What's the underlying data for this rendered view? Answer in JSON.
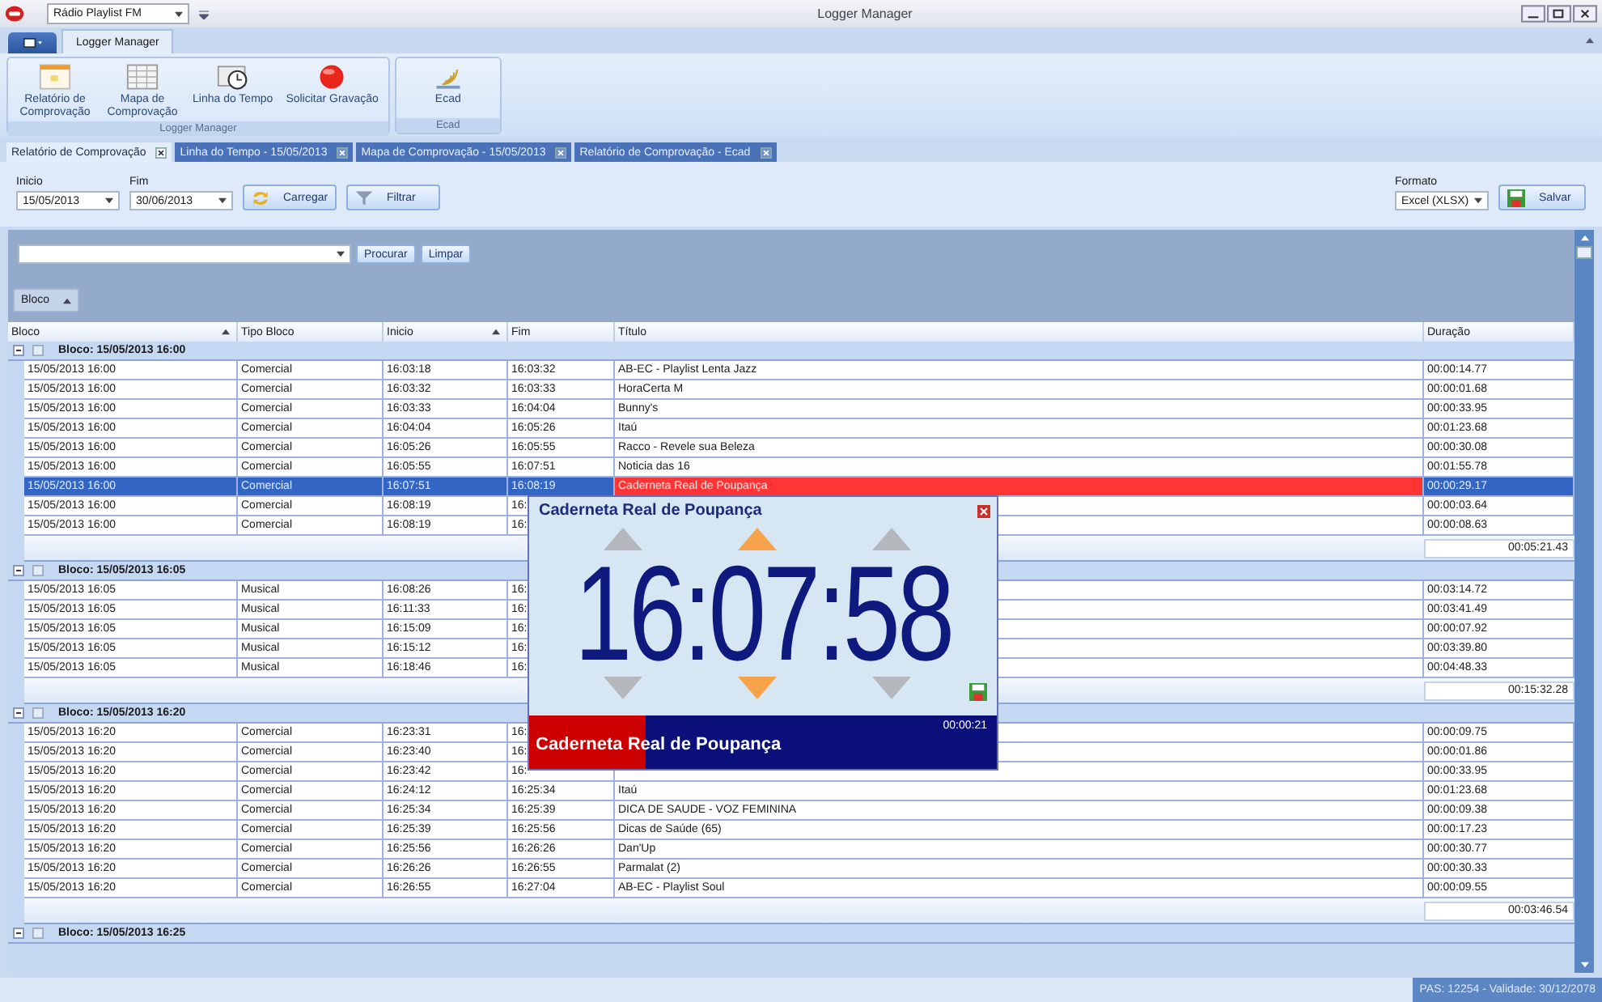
{
  "window": {
    "title": "Logger Manager",
    "station": "Rádio Playlist FM"
  },
  "ribbon": {
    "tabs": [
      {
        "label": "Logger Manager",
        "selected": true
      }
    ],
    "groups": [
      {
        "label": "Logger Manager",
        "buttons": [
          {
            "label": "Relatório de Comprovação",
            "kind": "report"
          },
          {
            "label": "Mapa de Comprovação",
            "kind": "map"
          },
          {
            "label": "Linha do Tempo",
            "kind": "timeline"
          },
          {
            "label": "Solicitar Gravação",
            "kind": "record"
          }
        ]
      },
      {
        "label": "Ecad",
        "buttons": [
          {
            "label": "Ecad",
            "kind": "ecad"
          }
        ]
      }
    ]
  },
  "doc_tabs": [
    {
      "label": "Relatório de Comprovação",
      "selected": true
    },
    {
      "label": "Linha do Tempo - 15/05/2013",
      "selected": false
    },
    {
      "label": "Mapa de Comprovação - 15/05/2013",
      "selected": false
    },
    {
      "label": "Relatório de Comprovação - Ecad",
      "selected": false
    }
  ],
  "filter": {
    "start": {
      "label": "Inicio",
      "value": "15/05/2013"
    },
    "end": {
      "label": "Fim",
      "value": "30/06/2013"
    },
    "load_button": "Carregar",
    "filter_button": "Filtrar",
    "format": {
      "label": "Formato",
      "value": "Excel (XLSX)"
    },
    "save_button": "Salvar"
  },
  "search": {
    "search_button": "Procurar",
    "clear_button": "Limpar"
  },
  "group_by": {
    "label": "Bloco"
  },
  "table": {
    "columns": [
      {
        "label": "Bloco",
        "sorted": true
      },
      {
        "label": "Tipo Bloco",
        "sorted": false
      },
      {
        "label": "Inicio",
        "sorted": true
      },
      {
        "label": "Fim",
        "sorted": false
      },
      {
        "label": "Título",
        "sorted": false
      },
      {
        "label": "Duração",
        "sorted": false
      }
    ],
    "groups": [
      {
        "label": "Bloco: 15/05/2013 16:00",
        "expanded": true,
        "checked": false,
        "total": "00:05:21.43",
        "rows": [
          {
            "bloco": "15/05/2013 16:00",
            "tipo": "Comercial",
            "inicio": "16:03:18",
            "fim": "16:03:32",
            "titulo": "AB-EC - Playlist Lenta Jazz",
            "duracao": "00:00:14.77",
            "selected": false
          },
          {
            "bloco": "15/05/2013 16:00",
            "tipo": "Comercial",
            "inicio": "16:03:32",
            "fim": "16:03:33",
            "titulo": "HoraCerta M",
            "duracao": "00:00:01.68",
            "selected": false
          },
          {
            "bloco": "15/05/2013 16:00",
            "tipo": "Comercial",
            "inicio": "16:03:33",
            "fim": "16:04:04",
            "titulo": "Bunny's",
            "duracao": "00:00:33.95",
            "selected": false
          },
          {
            "bloco": "15/05/2013 16:00",
            "tipo": "Comercial",
            "inicio": "16:04:04",
            "fim": "16:05:26",
            "titulo": "Itaú",
            "duracao": "00:01:23.68",
            "selected": false
          },
          {
            "bloco": "15/05/2013 16:00",
            "tipo": "Comercial",
            "inicio": "16:05:26",
            "fim": "16:05:55",
            "titulo": "Racco - Revele sua Beleza",
            "duracao": "00:00:30.08",
            "selected": false
          },
          {
            "bloco": "15/05/2013 16:00",
            "tipo": "Comercial",
            "inicio": "16:05:55",
            "fim": "16:07:51",
            "titulo": "Noticia das 16",
            "duracao": "00:01:55.78",
            "selected": false
          },
          {
            "bloco": "15/05/2013 16:00",
            "tipo": "Comercial",
            "inicio": "16:07:51",
            "fim": "16:08:19",
            "titulo": "Caderneta Real de Poupança",
            "duracao": "00:00:29.17",
            "selected": true
          },
          {
            "bloco": "15/05/2013 16:00",
            "tipo": "Comercial",
            "inicio": "16:08:19",
            "fim": "16:",
            "duracao": "00:00:03.64",
            "selected": false
          },
          {
            "bloco": "15/05/2013 16:00",
            "tipo": "Comercial",
            "inicio": "16:08:19",
            "fim": "16:",
            "duracao": "00:00:08.63",
            "selected": false
          }
        ]
      },
      {
        "label": "Bloco: 15/05/2013 16:05",
        "expanded": true,
        "checked": false,
        "total": "00:15:32.28",
        "rows": [
          {
            "bloco": "15/05/2013 16:05",
            "tipo": "Musical",
            "inicio": "16:08:26",
            "fim": "16:",
            "duracao": "00:03:14.72",
            "selected": false
          },
          {
            "bloco": "15/05/2013 16:05",
            "tipo": "Musical",
            "inicio": "16:11:33",
            "fim": "16:",
            "duracao": "00:03:41.49",
            "selected": false
          },
          {
            "bloco": "15/05/2013 16:05",
            "tipo": "Musical",
            "inicio": "16:15:09",
            "fim": "16:",
            "duracao": "00:00:07.92",
            "selected": false
          },
          {
            "bloco": "15/05/2013 16:05",
            "tipo": "Musical",
            "inicio": "16:15:12",
            "fim": "16:",
            "duracao": "00:03:39.80",
            "selected": false
          },
          {
            "bloco": "15/05/2013 16:05",
            "tipo": "Musical",
            "inicio": "16:18:46",
            "fim": "16:",
            "duracao": "00:04:48.33",
            "selected": false
          }
        ]
      },
      {
        "label": "Bloco: 15/05/2013 16:20",
        "expanded": true,
        "checked": false,
        "total": "00:03:46.54",
        "rows": [
          {
            "bloco": "15/05/2013 16:20",
            "tipo": "Comercial",
            "inicio": "16:23:31",
            "fim": "16:",
            "duracao": "00:00:09.75",
            "selected": false
          },
          {
            "bloco": "15/05/2013 16:20",
            "tipo": "Comercial",
            "inicio": "16:23:40",
            "fim": "16:",
            "duracao": "00:00:01.86",
            "selected": false
          },
          {
            "bloco": "15/05/2013 16:20",
            "tipo": "Comercial",
            "inicio": "16:23:42",
            "fim": "16:",
            "duracao": "00:00:33.95",
            "selected": false
          },
          {
            "bloco": "15/05/2013 16:20",
            "tipo": "Comercial",
            "inicio": "16:24:12",
            "fim": "16:25:34",
            "titulo": "Itaú",
            "duracao": "00:01:23.68",
            "selected": false
          },
          {
            "bloco": "15/05/2013 16:20",
            "tipo": "Comercial",
            "inicio": "16:25:34",
            "fim": "16:25:39",
            "titulo": "DICA DE SAUDE - VOZ FEMININA",
            "duracao": "00:00:09.38",
            "selected": false
          },
          {
            "bloco": "15/05/2013 16:20",
            "tipo": "Comercial",
            "inicio": "16:25:39",
            "fim": "16:25:56",
            "titulo": "Dicas de Saúde (65)",
            "duracao": "00:00:17.23",
            "selected": false
          },
          {
            "bloco": "15/05/2013 16:20",
            "tipo": "Comercial",
            "inicio": "16:25:56",
            "fim": "16:26:26",
            "titulo": "Dan'Up",
            "duracao": "00:00:30.77",
            "selected": false
          },
          {
            "bloco": "15/05/2013 16:20",
            "tipo": "Comercial",
            "inicio": "16:26:26",
            "fim": "16:26:55",
            "titulo": "Parmalat (2)",
            "duracao": "00:00:30.33",
            "selected": false
          },
          {
            "bloco": "15/05/2013 16:20",
            "tipo": "Comercial",
            "inicio": "16:26:55",
            "fim": "16:27:04",
            "titulo": "AB-EC - Playlist Soul",
            "duracao": "00:00:09.55",
            "selected": false
          }
        ]
      },
      {
        "label": "Bloco: 15/05/2013 16:25",
        "expanded": true,
        "checked": false
      }
    ]
  },
  "popup": {
    "title": "Caderneta Real de Poupança",
    "time": "16:07:58",
    "spinners": [
      {
        "selected": false
      },
      {
        "selected": true
      },
      {
        "selected": false
      }
    ],
    "now_playing": "Caderneta Real de Poupança",
    "elapsed": "00:00:21",
    "progress": {
      "level": 0.25
    }
  },
  "status_bar": {
    "text": "PAS: 12254 - Validade: 30/12/2078"
  }
}
